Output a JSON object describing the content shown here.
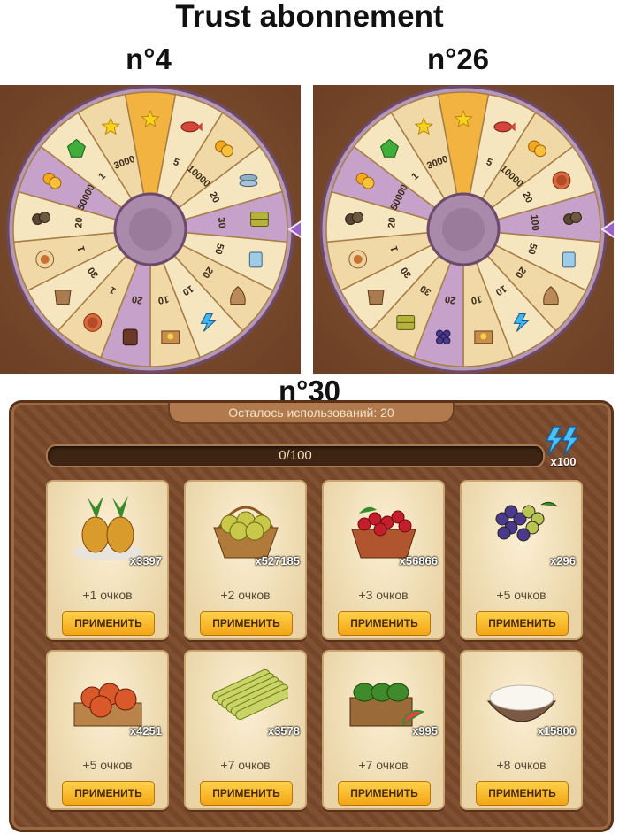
{
  "title": "Trust abonnement",
  "wheels": [
    {
      "label": "n°4",
      "segments": [
        {
          "icon": "stars-icon",
          "amount": ""
        },
        {
          "icon": "fish-icon",
          "amount": "5"
        },
        {
          "icon": "coins-icon",
          "amount": "10000"
        },
        {
          "icon": "fish-bundle-icon",
          "amount": "20"
        },
        {
          "icon": "package-icon",
          "amount": "30"
        },
        {
          "icon": "paint-bucket-icon",
          "amount": "50"
        },
        {
          "icon": "sack-icon",
          "amount": "20"
        },
        {
          "icon": "lightning-icon",
          "amount": "10"
        },
        {
          "icon": "crate-icon",
          "amount": "10"
        },
        {
          "icon": "chocolate-icon",
          "amount": "20"
        },
        {
          "icon": "pie-icon",
          "amount": "1"
        },
        {
          "icon": "bag-icon",
          "amount": "30"
        },
        {
          "icon": "clam-icon",
          "amount": "1"
        },
        {
          "icon": "nuts-icon",
          "amount": "20"
        },
        {
          "icon": "coins-icon",
          "amount": "50000"
        },
        {
          "icon": "emerald-icon",
          "amount": "1"
        },
        {
          "icon": "stars-icon",
          "amount": "3000"
        }
      ]
    },
    {
      "label": "n°26",
      "segments": [
        {
          "icon": "stars-icon",
          "amount": ""
        },
        {
          "icon": "fish-icon",
          "amount": "5"
        },
        {
          "icon": "coins-icon",
          "amount": "10000"
        },
        {
          "icon": "pie-icon",
          "amount": "20"
        },
        {
          "icon": "nuts-icon",
          "amount": "100"
        },
        {
          "icon": "paint-bucket-icon",
          "amount": "50"
        },
        {
          "icon": "sack-icon",
          "amount": "20"
        },
        {
          "icon": "lightning-icon",
          "amount": "10"
        },
        {
          "icon": "crate-icon",
          "amount": "10"
        },
        {
          "icon": "grapes-icon",
          "amount": "20"
        },
        {
          "icon": "package-icon",
          "amount": "30"
        },
        {
          "icon": "bag-icon",
          "amount": "30"
        },
        {
          "icon": "clam-icon",
          "amount": "1"
        },
        {
          "icon": "nuts-icon",
          "amount": "20"
        },
        {
          "icon": "coins-icon",
          "amount": "50000"
        },
        {
          "icon": "emerald-icon",
          "amount": "1"
        },
        {
          "icon": "stars-icon",
          "amount": "3000"
        }
      ]
    }
  ],
  "shop": {
    "label": "n°30",
    "usage_text": "Осталось использований: 20",
    "progress_text": "0/100",
    "progress_fraction": 0,
    "energy_count": "x100",
    "items": [
      {
        "icon": "pineapple-icon",
        "qty": "x3397",
        "points": "+1 очков",
        "button": "ПРИМЕНИТЬ"
      },
      {
        "icon": "pear-basket-icon",
        "qty": "x527185",
        "points": "+2 очков",
        "button": "ПРИМЕНИТЬ"
      },
      {
        "icon": "cherry-basket-icon",
        "qty": "x56866",
        "points": "+3 очков",
        "button": "ПРИМЕНИТЬ"
      },
      {
        "icon": "grapes-basket-icon",
        "qty": "x296",
        "points": "+5 очков",
        "button": "ПРИМЕНИТЬ"
      },
      {
        "icon": "apple-crate-icon",
        "qty": "x4251",
        "points": "+5 очков",
        "button": "ПРИМЕНИТЬ"
      },
      {
        "icon": "sugarcane-icon",
        "qty": "x3578",
        "points": "+7 очков",
        "button": "ПРИМЕНИТЬ"
      },
      {
        "icon": "watermelon-crate-icon",
        "qty": "x995",
        "points": "+7 очков",
        "button": "ПРИМЕНИТЬ"
      },
      {
        "icon": "rice-bowl-icon",
        "qty": "x15800",
        "points": "+8 очков",
        "button": "ПРИМЕНИТЬ"
      }
    ]
  }
}
